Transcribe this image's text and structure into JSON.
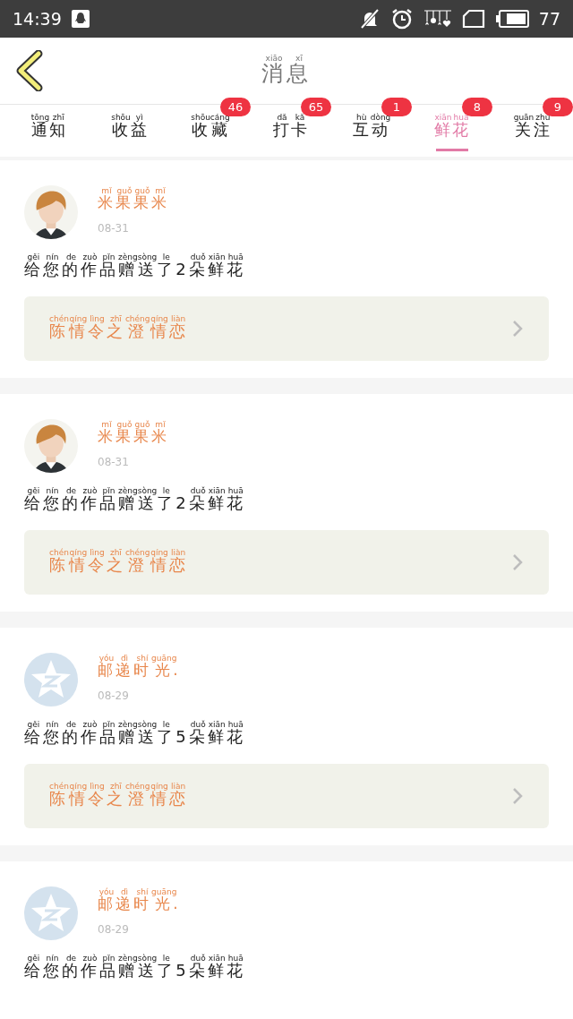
{
  "status_bar": {
    "time": "14:39",
    "battery_text": "77"
  },
  "header": {
    "title": [
      [
        "xiāo",
        "消"
      ],
      [
        "xī",
        "息"
      ]
    ]
  },
  "tabs": [
    {
      "label": [
        [
          "tōng",
          "通"
        ],
        [
          "zhī",
          "知"
        ]
      ],
      "selected": false
    },
    {
      "label": [
        [
          "shōu",
          "收"
        ],
        [
          "yì",
          "益"
        ]
      ],
      "selected": false
    },
    {
      "label": [
        [
          "shōu",
          "收"
        ],
        [
          "cáng",
          "藏"
        ]
      ],
      "selected": false,
      "badge": "46"
    },
    {
      "label": [
        [
          "dǎ",
          "打"
        ],
        [
          "kǎ",
          "卡"
        ]
      ],
      "selected": false,
      "badge": "65"
    },
    {
      "label": [
        [
          "hù",
          "互"
        ],
        [
          "dòng",
          "动"
        ]
      ],
      "selected": false,
      "badge": "1"
    },
    {
      "label": [
        [
          "xiān",
          "鲜"
        ],
        [
          "huā",
          "花"
        ]
      ],
      "selected": true,
      "badge": "8"
    },
    {
      "label": [
        [
          "guān",
          "关"
        ],
        [
          "zhù",
          "注"
        ]
      ],
      "selected": false,
      "badge": "9"
    }
  ],
  "messages": [
    {
      "avatar": {
        "kind": "picture"
      },
      "name": [
        [
          "mǐ",
          "米"
        ],
        [
          "guǒ",
          "果"
        ],
        [
          "guǒ",
          "果"
        ],
        [
          "mǐ",
          "米"
        ]
      ],
      "date": "08-31",
      "text": [
        [
          "gěi",
          "给"
        ],
        [
          "nín",
          "您"
        ],
        [
          "de",
          "的"
        ],
        [
          "zuò",
          "作"
        ],
        [
          "pǐn",
          "品"
        ],
        [
          "zèng",
          "赠"
        ],
        [
          "sòng",
          "送"
        ],
        [
          "le",
          "了"
        ],
        [
          "2"
        ],
        [
          "duǒ",
          "朵"
        ],
        [
          "xiān",
          "鲜"
        ],
        [
          "huā",
          "花"
        ]
      ],
      "work": [
        [
          "chén",
          "陈"
        ],
        [
          "qíng",
          "情"
        ],
        [
          "lìng",
          "令"
        ],
        [
          "zhī",
          "之"
        ],
        [
          "chéng",
          "澄"
        ],
        [
          "qíng",
          "情"
        ],
        [
          "liàn",
          "恋"
        ]
      ]
    },
    {
      "avatar": {
        "kind": "picture"
      },
      "name": [
        [
          "mǐ",
          "米"
        ],
        [
          "guǒ",
          "果"
        ],
        [
          "guǒ",
          "果"
        ],
        [
          "mǐ",
          "米"
        ]
      ],
      "date": "08-31",
      "text": [
        [
          "gěi",
          "给"
        ],
        [
          "nín",
          "您"
        ],
        [
          "de",
          "的"
        ],
        [
          "zuò",
          "作"
        ],
        [
          "pǐn",
          "品"
        ],
        [
          "zèng",
          "赠"
        ],
        [
          "sòng",
          "送"
        ],
        [
          "le",
          "了"
        ],
        [
          "2"
        ],
        [
          "duǒ",
          "朵"
        ],
        [
          "xiān",
          "鲜"
        ],
        [
          "huā",
          "花"
        ]
      ],
      "work": [
        [
          "chén",
          "陈"
        ],
        [
          "qíng",
          "情"
        ],
        [
          "lìng",
          "令"
        ],
        [
          "zhī",
          "之"
        ],
        [
          "chéng",
          "澄"
        ],
        [
          "qíng",
          "情"
        ],
        [
          "liàn",
          "恋"
        ]
      ]
    },
    {
      "avatar": {
        "kind": "default"
      },
      "name": [
        [
          "yóu",
          "邮"
        ],
        [
          "dì",
          "递"
        ],
        [
          "shí",
          "时"
        ],
        [
          "guāng",
          "光"
        ],
        [
          "."
        ]
      ],
      "date": "08-29",
      "text": [
        [
          "gěi",
          "给"
        ],
        [
          "nín",
          "您"
        ],
        [
          "de",
          "的"
        ],
        [
          "zuò",
          "作"
        ],
        [
          "pǐn",
          "品"
        ],
        [
          "zèng",
          "赠"
        ],
        [
          "sòng",
          "送"
        ],
        [
          "le",
          "了"
        ],
        [
          "5"
        ],
        [
          "duǒ",
          "朵"
        ],
        [
          "xiān",
          "鲜"
        ],
        [
          "huā",
          "花"
        ]
      ],
      "work": [
        [
          "chén",
          "陈"
        ],
        [
          "qíng",
          "情"
        ],
        [
          "lìng",
          "令"
        ],
        [
          "zhī",
          "之"
        ],
        [
          "chéng",
          "澄"
        ],
        [
          "qíng",
          "情"
        ],
        [
          "liàn",
          "恋"
        ]
      ]
    },
    {
      "avatar": {
        "kind": "default"
      },
      "name": [
        [
          "yóu",
          "邮"
        ],
        [
          "dì",
          "递"
        ],
        [
          "shí",
          "时"
        ],
        [
          "guāng",
          "光"
        ],
        [
          "."
        ]
      ],
      "date": "08-29",
      "text": [
        [
          "gěi",
          "给"
        ],
        [
          "nín",
          "您"
        ],
        [
          "de",
          "的"
        ],
        [
          "zuò",
          "作"
        ],
        [
          "pǐn",
          "品"
        ],
        [
          "zèng",
          "赠"
        ],
        [
          "sòng",
          "送"
        ],
        [
          "le",
          "了"
        ],
        [
          "5"
        ],
        [
          "duǒ",
          "朵"
        ],
        [
          "xiān",
          "鲜"
        ],
        [
          "huā",
          "花"
        ]
      ]
    }
  ]
}
